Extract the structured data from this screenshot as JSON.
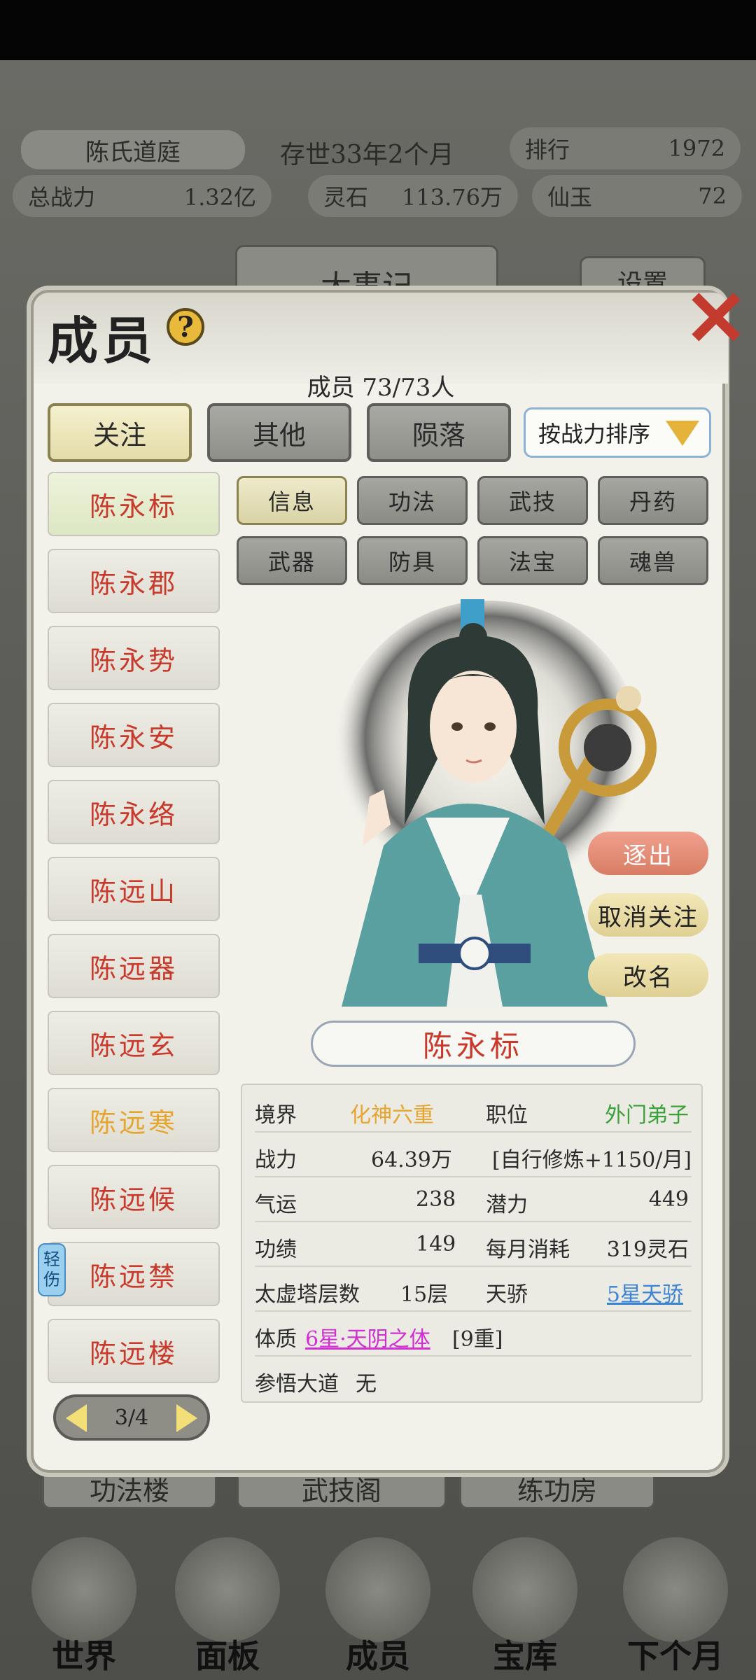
{
  "header": {
    "sect_name": "陈氏道庭",
    "existence": "存世33年2个月",
    "rank_label": "排行",
    "rank_value": "1972",
    "power_label": "总战力",
    "power_value": "1.32亿",
    "spirit_stone_label": "灵石",
    "spirit_stone_value": "113.76万",
    "jade_label": "仙玉",
    "jade_value": "72"
  },
  "background": {
    "events_tab": "大事记",
    "settings_tab": "设置",
    "buildings": [
      "功法楼",
      "武技阁",
      "练功房"
    ],
    "bottom_nav": [
      "世界",
      "面板",
      "成员",
      "宝库",
      "下个月"
    ]
  },
  "modal": {
    "title": "成员",
    "help_glyph": "?",
    "close_glyph": "✕",
    "member_count": "成员  73/73人",
    "tabs": [
      "关注",
      "其他",
      "陨落"
    ],
    "sort_label": "按战力排序",
    "members": [
      "陈永标",
      "陈永郡",
      "陈永势",
      "陈永安",
      "陈永络",
      "陈远山",
      "陈远器",
      "陈远玄",
      "陈远寒",
      "陈远候",
      "陈远禁",
      "陈远楼"
    ],
    "injury_badge": [
      "轻",
      "伤"
    ],
    "subtabs_row1": [
      "信息",
      "功法",
      "武技",
      "丹药"
    ],
    "subtabs_row2": [
      "武器",
      "防具",
      "法宝",
      "魂兽"
    ],
    "actions": {
      "leave": "逐出",
      "unfollow": "取消关注",
      "rename": "改名"
    },
    "selected_name": "陈永标",
    "info": {
      "realm_label": "境界",
      "realm_value": "化神六重",
      "position_label": "职位",
      "position_value": "外门弟子",
      "power_label": "战力",
      "power_value": "64.39万",
      "cultivation_value": "[自行修炼+1150/月]",
      "luck_label": "气运",
      "luck_value": "238",
      "potential_label": "潜力",
      "potential_value": "449",
      "merit_label": "功绩",
      "merit_value": "149",
      "consume_label": "每月消耗",
      "consume_value": "319灵石",
      "tower_label": "太虚塔层数",
      "tower_value": "15层",
      "talent_label": "天骄",
      "talent_value": "5星天骄",
      "physique_label": "体质",
      "physique_value": "6星·天阴之体",
      "physique_level": "[9重]",
      "dao_label": "参悟大道",
      "dao_value": "无"
    },
    "pager": "3/4"
  },
  "colors": {
    "name_red": "#c9392c",
    "realm_orange": "#e6a52f",
    "position_green": "#3aa13a",
    "talent_blue": "#3b83d4",
    "physique_magenta": "#d12fd1"
  }
}
